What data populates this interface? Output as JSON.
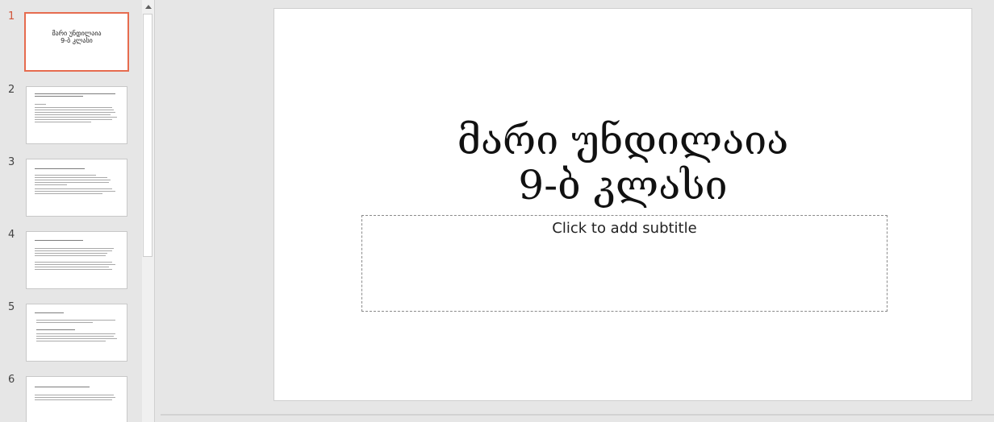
{
  "slide_title_text": "მარი უნდილაია\n9-ბ კლასი",
  "subtitle_placeholder": "Click to add subtitle",
  "thumbnails": [
    {
      "number": "1",
      "title": "მარი უნდილაია\n9-ბ კლასი",
      "selected": true
    },
    {
      "number": "2",
      "selected": false
    },
    {
      "number": "3",
      "selected": false
    },
    {
      "number": "4",
      "selected": false
    },
    {
      "number": "5",
      "selected": false
    },
    {
      "number": "6",
      "selected": false
    }
  ],
  "colors": {
    "selected_accent": "#e66c4f",
    "selected_number": "#d2553a",
    "background": "#e6e6e6"
  },
  "icons": {
    "scroll_up": "triangle-up-icon"
  }
}
